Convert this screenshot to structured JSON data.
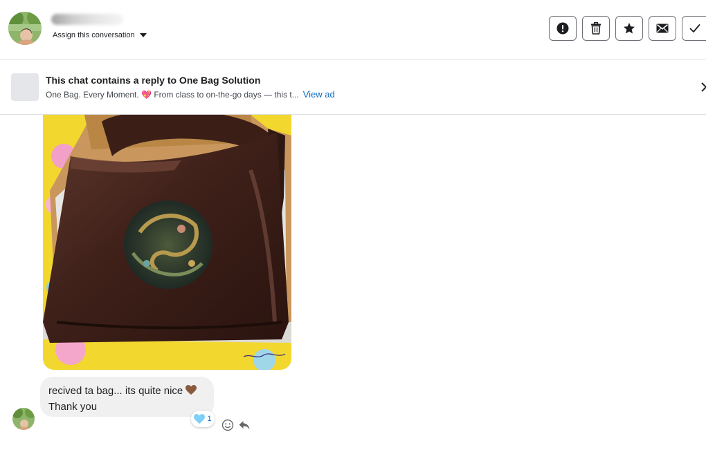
{
  "header": {
    "assign_label": "Assign this conversation",
    "toolbar": {
      "icons": [
        "alert-icon",
        "trash-icon",
        "star-icon",
        "mail-icon",
        "check-icon"
      ]
    }
  },
  "ad_banner": {
    "title": "This chat contains a reply to One Bag Solution",
    "description": "One Bag. Every Moment. 💖 From class to on-the-go days — this t...",
    "view_ad_label": "View ad"
  },
  "messages": [
    {
      "type": "image",
      "subject": "brown leather shoulder bag with embroidered circular patch in a cardboard box"
    },
    {
      "type": "text",
      "lines": [
        "recived ta bag... its quite nice",
        "Thank you"
      ],
      "reaction": {
        "emoji": "light-blue-heart",
        "count": "1"
      }
    }
  ],
  "colors": {
    "link": "#0a6cc4",
    "bubble": "#f0f0f0",
    "divider": "#dcdfe3",
    "button_border": "#6b6f75",
    "reaction_heart": "#7fd0f5",
    "bag_leather": "#4a2a22"
  }
}
